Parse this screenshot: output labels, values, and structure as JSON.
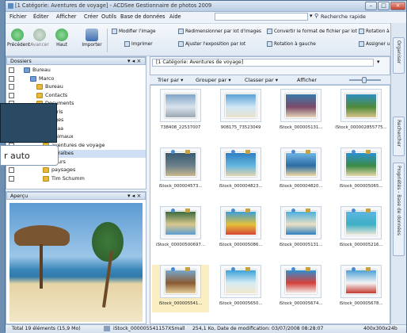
{
  "window": {
    "title": "[1 Catégorie: Aventures de voyage] - ACDSee Gestionnaire de photos 2009",
    "controls": [
      "–",
      "□",
      "×"
    ]
  },
  "menu": [
    "Fichier",
    "Éditer",
    "Afficher",
    "Créer",
    "Outils",
    "Base de données",
    "Aide"
  ],
  "quick_search": {
    "label": "Recherche rapide",
    "value": ""
  },
  "toolbar": {
    "nav": [
      {
        "label": "Précédent",
        "color": "#3aa84a"
      },
      {
        "label": "Avancer",
        "color": "#9fb7a3"
      },
      {
        "label": "Haut",
        "color": "#3aa84a"
      },
      {
        "label": "Importer",
        "color": "#3f6fb0"
      }
    ],
    "actions": [
      "Modifier l'image",
      "Redimensionner par lot d'images",
      "Convertir le format de fichier par lot",
      "Rotation à",
      "Imprimer",
      "Ajuster l'exposition par lot",
      "Rotation à gauche",
      "Assigner u"
    ]
  },
  "side_tabs": [
    "Organiser",
    "Rechercher",
    "Propriétés - Base de données"
  ],
  "folders": {
    "title": "Dossiers",
    "items": [
      {
        "label": "Bureau",
        "level": 1
      },
      {
        "label": "Marco",
        "level": 2
      },
      {
        "label": "Bureau",
        "level": 3
      },
      {
        "label": "Contacts",
        "level": 3
      },
      {
        "label": "Documents",
        "level": 3
      },
      {
        "label": "Favoris",
        "level": 3
      },
      {
        "label": "Images",
        "level": 3
      },
      {
        "label": "asaa",
        "level": 4
      },
      {
        "label": "animaux",
        "level": 4
      },
      {
        "label": "aventures de voyage",
        "level": 4
      },
      {
        "label": "Caraïbes",
        "level": 4
      },
      {
        "label": "fleurs",
        "level": 4
      },
      {
        "label": "paysages",
        "level": 4
      },
      {
        "label": "Tim Schumm",
        "level": 4
      }
    ]
  },
  "preview": {
    "title": "Aperçu"
  },
  "main": {
    "path": "[1 Catégorie: Aventures de voyage]",
    "sort": [
      "Trier par",
      "Grouper par",
      "Classer par",
      "Afficher"
    ]
  },
  "thumbnails": [
    {
      "name": "738408_22537007",
      "colors": [
        "#7fa4c7",
        "#d9e3ec",
        "#9aa7b3"
      ]
    },
    {
      "name": "908175_73523049",
      "colors": [
        "#5aa0d6",
        "#cfe6f5",
        "#e9e2cf"
      ]
    },
    {
      "name": "iStock_000005131...",
      "colors": [
        "#3a78a8",
        "#7b4a6a",
        "#e5d4b8"
      ]
    },
    {
      "name": "iStock_000002855775...",
      "colors": [
        "#2f8fc0",
        "#4f8a3a",
        "#d8c48a"
      ]
    },
    {
      "name": "iStock_000004573...",
      "colors": [
        "#3a5a72",
        "#6b7f8a",
        "#c9b78d"
      ]
    },
    {
      "name": "iStock_000004823...",
      "colors": [
        "#2d7fc2",
        "#65b6de",
        "#e2d5b0"
      ]
    },
    {
      "name": "iStock_000004820...",
      "colors": [
        "#6fb6e4",
        "#2b6da3",
        "#f0d9a5"
      ]
    },
    {
      "name": "iStock_000005065...",
      "colors": [
        "#2c91d1",
        "#3a8a44",
        "#e7d8a7"
      ]
    },
    {
      "name": "iStock_00000500697...",
      "colors": [
        "#3a6b3f",
        "#d9c78e",
        "#5c9dd1"
      ]
    },
    {
      "name": "iStock_000005086...",
      "colors": [
        "#3b9fd8",
        "#e4c03c",
        "#d64535"
      ]
    },
    {
      "name": "iStock_000005131...",
      "colors": [
        "#4ab0e0",
        "#eae0c4",
        "#2f7fbf"
      ]
    },
    {
      "name": "iStock_000005216...",
      "colors": [
        "#5fb5e2",
        "#3cb0c4",
        "#e9e5d8"
      ]
    },
    {
      "name": "iStock_000005541...",
      "colors": [
        "#77a8cc",
        "#8a5a34",
        "#e5cf9a"
      ]
    },
    {
      "name": "iStock_000005650...",
      "colors": [
        "#3aa0d8",
        "#d7ecf5",
        "#f0e6c9"
      ]
    },
    {
      "name": "iStock_000005674...",
      "colors": [
        "#2f8ed0",
        "#d7413a",
        "#f2f2ee"
      ]
    },
    {
      "name": "iStock_000005678...",
      "colors": [
        "#4d9fd6",
        "#f4f4f4",
        "#c33a2f"
      ]
    }
  ],
  "status": {
    "count": "Total 19 éléments (15,9 Mo)",
    "file": "iStock_000005541157XSmall",
    "info": "254,1 Ko, Date de modification: 03/07/2008 08:28:07",
    "dims": "400x300x24b"
  },
  "overlay": {
    "button_label": "r auto"
  }
}
